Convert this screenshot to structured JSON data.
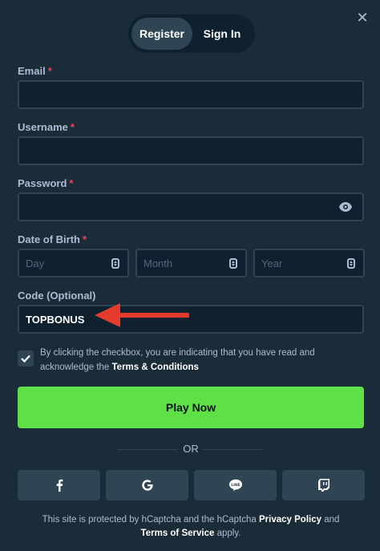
{
  "tabs": {
    "register": "Register",
    "signin": "Sign In"
  },
  "form": {
    "email_label": "Email",
    "username_label": "Username",
    "password_label": "Password",
    "dob_label": "Date of Birth",
    "required_mark": "*",
    "dob": {
      "day": "Day",
      "month": "Month",
      "year": "Year"
    },
    "code_label": "Code (Optional)",
    "code_value": "TOPBONUS"
  },
  "consent": {
    "text": "By clicking the checkbox, you are indicating that you have read and acknowledge the",
    "link": "Terms & Conditions",
    "checked": true
  },
  "play_button": "Play Now",
  "divider": "OR",
  "social": [
    "facebook-icon",
    "google-icon",
    "line-icon",
    "twitch-icon"
  ],
  "footer": {
    "prefix": "This site is protected by hCaptcha and the hCaptcha",
    "privacy": "Privacy Policy",
    "and": "and",
    "terms": "Terms of Service",
    "suffix": "apply."
  },
  "colors": {
    "background": "#1a2c38",
    "input_bg": "#0f212e",
    "accent_green": "#5fe046",
    "arrow_red": "#e53a2e"
  }
}
